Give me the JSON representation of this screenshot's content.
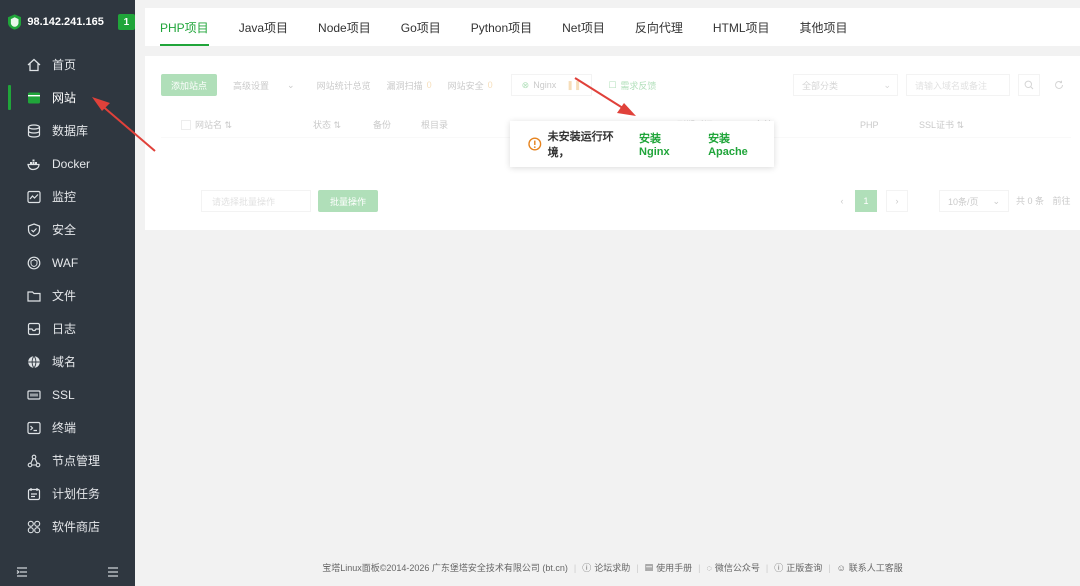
{
  "server": {
    "ip": "98.142.241.165",
    "badge": "1"
  },
  "sidebar": {
    "items": [
      {
        "label": "首页",
        "icon": "home-icon"
      },
      {
        "label": "网站",
        "icon": "website-icon"
      },
      {
        "label": "数据库",
        "icon": "database-icon"
      },
      {
        "label": "Docker",
        "icon": "docker-icon"
      },
      {
        "label": "监控",
        "icon": "monitor-icon"
      },
      {
        "label": "安全",
        "icon": "shield-icon"
      },
      {
        "label": "WAF",
        "icon": "waf-icon"
      },
      {
        "label": "文件",
        "icon": "folder-icon"
      },
      {
        "label": "日志",
        "icon": "log-icon"
      },
      {
        "label": "域名",
        "icon": "globe-icon"
      },
      {
        "label": "SSL",
        "icon": "ssl-icon"
      },
      {
        "label": "终端",
        "icon": "terminal-icon"
      },
      {
        "label": "节点管理",
        "icon": "node-icon"
      },
      {
        "label": "计划任务",
        "icon": "calendar-icon"
      },
      {
        "label": "软件商店",
        "icon": "store-icon"
      }
    ],
    "active_index": 1
  },
  "tabs": [
    "PHP项目",
    "Java项目",
    "Node项目",
    "Go项目",
    "Python项目",
    "Net项目",
    "反向代理",
    "HTML项目",
    "其他项目"
  ],
  "toolbar": {
    "add_site": "添加站点",
    "advanced": "高级设置",
    "stats": "网站统计总览",
    "vuln_scan": "漏洞扫描",
    "vuln_count": "0",
    "site_security": "网站安全",
    "security_count": "0",
    "nginx": "Nginx",
    "feedback": "需求反馈"
  },
  "filter": {
    "category": "全部分类",
    "search_placeholder": "请输入域名或备注"
  },
  "table": {
    "headers": [
      "网站名",
      "状态",
      "备份",
      "根目录",
      "到期时间",
      "备注",
      "PHP",
      "SSL证书"
    ]
  },
  "pager": {
    "batch_placeholder": "请选择批量操作",
    "batch_button": "批量操作",
    "current_page": "1",
    "per_page": "10条/页",
    "total": "共 0 条",
    "goto": "前往"
  },
  "popup": {
    "message": "未安装运行环境，",
    "install_nginx": "安装Nginx",
    "install_apache": "安装Apache"
  },
  "footer": {
    "copyright": "宝塔Linux面板©2014-2026 广东堡塔安全技术有限公司 (bt.cn)",
    "links": [
      "论坛求助",
      "使用手册",
      "微信公众号",
      "正版查询",
      "联系人工客服"
    ]
  },
  "colors": {
    "accent": "#20a53a",
    "sidebar_bg": "#2f3740",
    "arrow": "#e0413a"
  }
}
